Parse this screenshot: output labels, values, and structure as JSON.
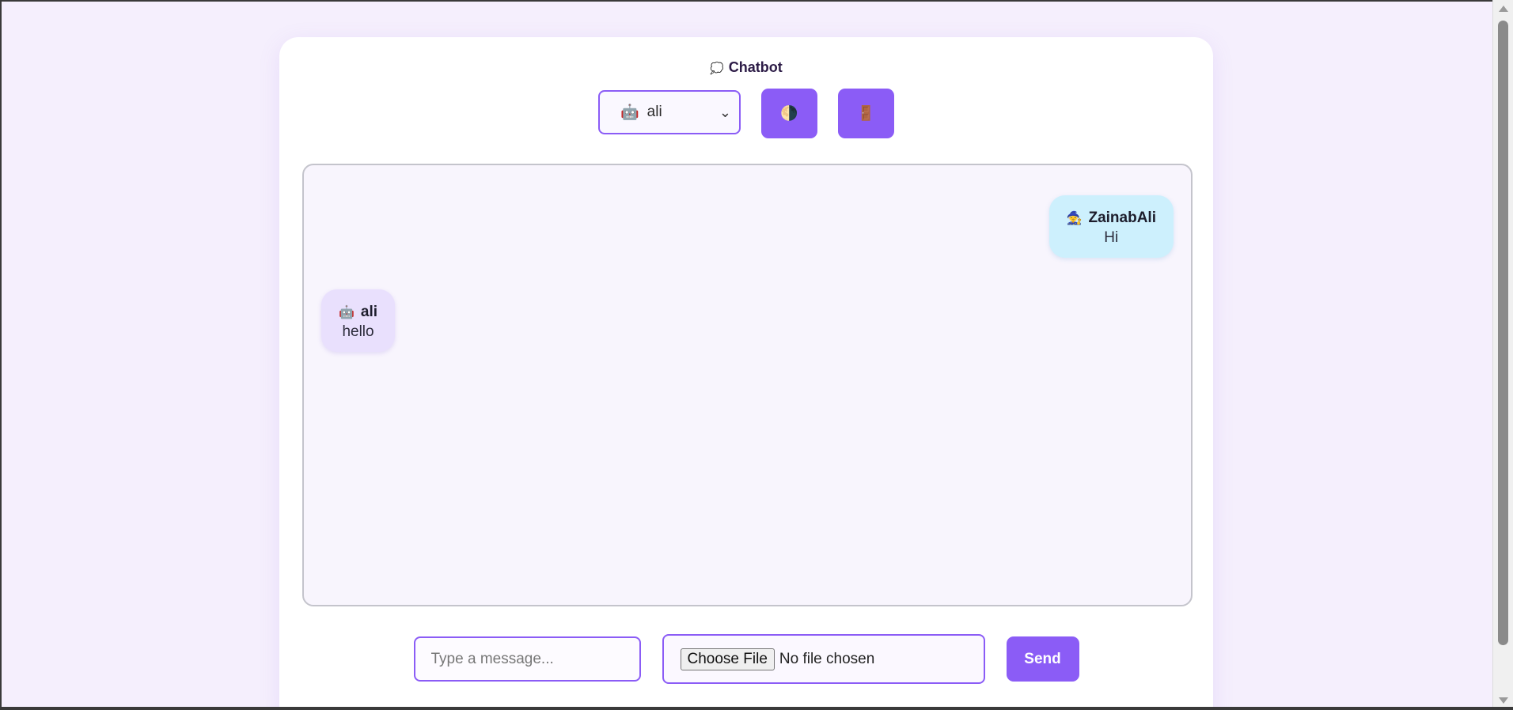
{
  "app": {
    "title": "Chatbot",
    "title_icon": "speech-bubble-icon"
  },
  "controls": {
    "bot_select": {
      "selected": "ali",
      "icon": "robot-icon"
    },
    "theme_button_icon": "half-moon-icon",
    "logout_button_icon": "door-icon",
    "accent_color": "#8b5cf6"
  },
  "messages": [
    {
      "role": "user",
      "sender": "ZainabAli",
      "sender_icon": "mage-icon",
      "text": "Hi"
    },
    {
      "role": "bot",
      "sender": "ali",
      "sender_icon": "robot-icon",
      "text": "hello"
    }
  ],
  "composer": {
    "message_placeholder": "Type a message...",
    "file_button_label": "Choose File",
    "file_status": "No file chosen",
    "send_label": "Send"
  }
}
